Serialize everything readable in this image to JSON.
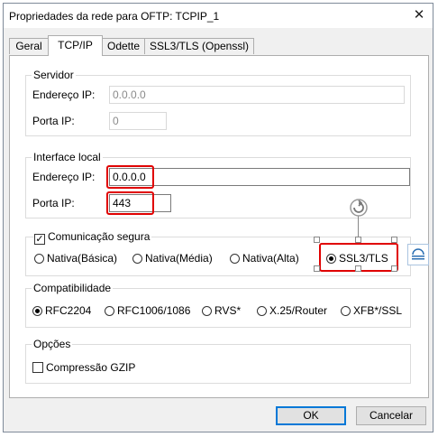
{
  "window": {
    "title": "Propriedades da rede para OFTP: TCPIP_1",
    "close_glyph": "✕"
  },
  "tabs": [
    {
      "label": "Geral"
    },
    {
      "label": "TCP/IP"
    },
    {
      "label": "Odette"
    },
    {
      "label": "SSL3/TLS (Openssl)"
    }
  ],
  "servidor": {
    "title": "Servidor",
    "ip_label": "Endereço IP:",
    "ip_value": "0.0.0.0",
    "port_label": "Porta IP:",
    "port_value": "0"
  },
  "interface_local": {
    "title": "Interface local",
    "ip_label": "Endereço IP:",
    "ip_value": "0.0.0.0",
    "port_label": "Porta IP:",
    "port_value": "443"
  },
  "comunicacao": {
    "checkbox_label": "Comunicação segura",
    "checked": true,
    "options": [
      {
        "label": "Nativa(Básica)",
        "selected": false
      },
      {
        "label": "Nativa(Média)",
        "selected": false
      },
      {
        "label": "Nativa(Alta)",
        "selected": false
      },
      {
        "label": "SSL3/TLS",
        "selected": true
      }
    ]
  },
  "compatibilidade": {
    "title": "Compatibilidade",
    "options": [
      {
        "label": "RFC2204",
        "selected": true
      },
      {
        "label": "RFC1006/1086",
        "selected": false
      },
      {
        "label": "RVS*",
        "selected": false
      },
      {
        "label": "X.25/Router",
        "selected": false
      },
      {
        "label": "XFB*/SSL",
        "selected": false
      }
    ]
  },
  "opcoes": {
    "title": "Opções",
    "gzip_label": "Compressão GZIP",
    "gzip_checked": false
  },
  "buttons": {
    "ok": "OK",
    "cancel": "Cancelar"
  },
  "colors": {
    "highlight": "#e00000",
    "default_button_border": "#0078d7"
  }
}
